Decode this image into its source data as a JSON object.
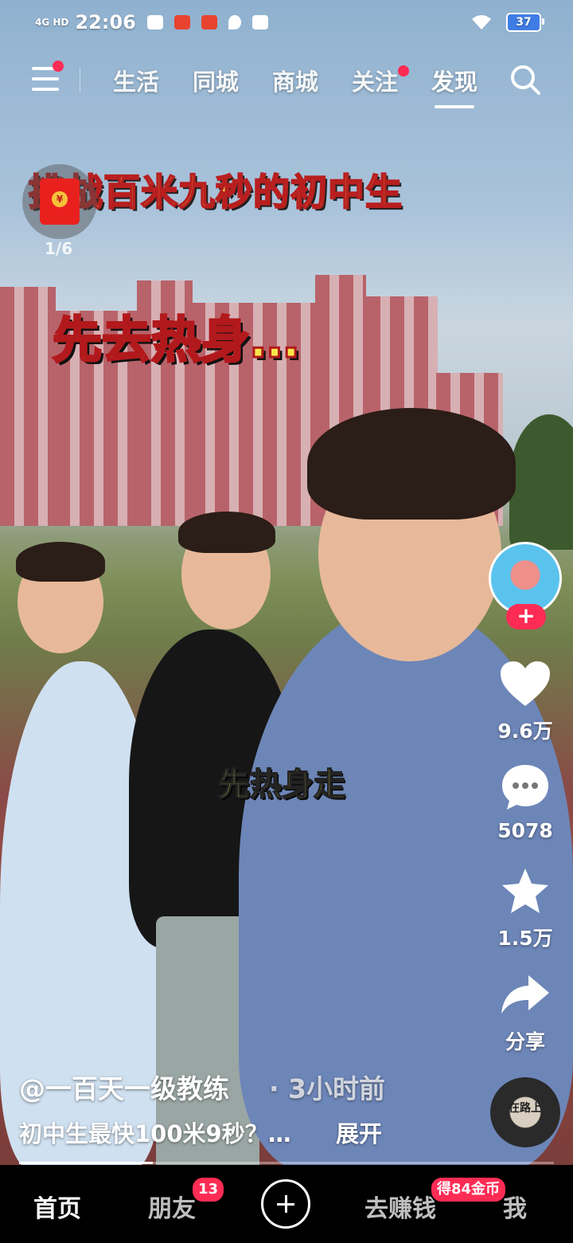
{
  "status_bar": {
    "network": "4G HD",
    "time": "22:06",
    "battery": "37"
  },
  "top_nav": {
    "tabs": [
      {
        "label": "生活"
      },
      {
        "label": "同城"
      },
      {
        "label": "商城"
      },
      {
        "label": "关注"
      },
      {
        "label": "发现"
      }
    ],
    "active_tab": "发现"
  },
  "red_packet": {
    "counter": "1/6"
  },
  "video": {
    "captions": {
      "title": "挑战百米九秒的初中生",
      "warm_up": "先去热身…",
      "subtitle": "先热身走"
    }
  },
  "actions": {
    "likes": "9.6万",
    "comments": "5078",
    "favorites": "1.5万",
    "share": "分享"
  },
  "post": {
    "author": "@一百天一级教练",
    "time": "· 3小时前",
    "description": "初中生最快100米9秒？…",
    "expand": "展开",
    "progress": 0.25
  },
  "disc": {
    "text": "在路上"
  },
  "bottom_nav": {
    "home": "首页",
    "friends": "朋友",
    "friends_badge": "13",
    "earn": "去赚钱",
    "earn_badge": "得84金币",
    "me": "我"
  },
  "colors": {
    "accent": "#fe2c55",
    "caption_yellow": "#f6e84a",
    "caption_red": "#b81f1f"
  }
}
